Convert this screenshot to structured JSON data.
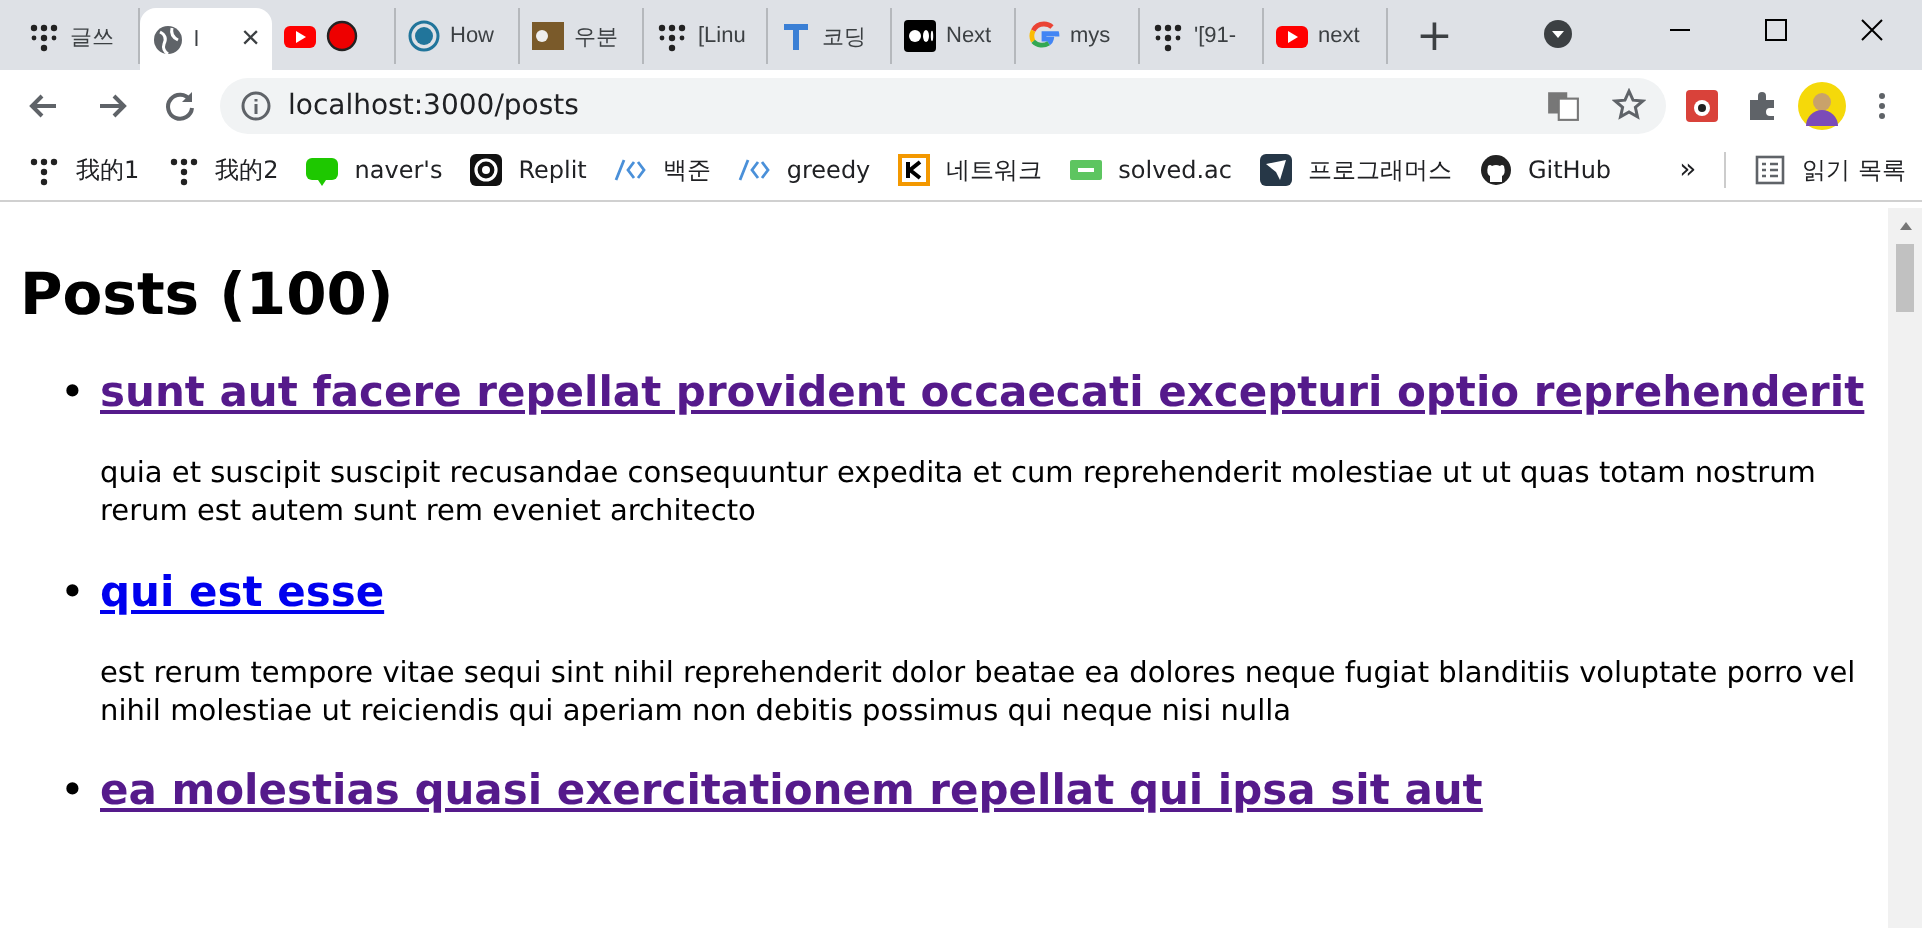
{
  "tabs": [
    {
      "label": "글쓰",
      "selected": false
    },
    {
      "label": "l",
      "selected": true,
      "close": "×"
    },
    {
      "selected": false
    },
    {
      "label": "How",
      "selected": false
    },
    {
      "label": "우분",
      "selected": false
    },
    {
      "label": "[Linu",
      "selected": false
    },
    {
      "label": "코딩",
      "selected": false
    },
    {
      "label": "Next",
      "selected": false
    },
    {
      "label": "mys",
      "selected": false
    },
    {
      "label": "'[91-",
      "selected": false
    },
    {
      "label": "next",
      "selected": false
    }
  ],
  "new_tab": "+",
  "address": "localhost:3000/posts",
  "bookmarks": [
    {
      "label": "我的1"
    },
    {
      "label": "我的2"
    },
    {
      "label": "naver's"
    },
    {
      "label": "Replit"
    },
    {
      "label": "백준"
    },
    {
      "label": "greedy"
    },
    {
      "label": "네트워크"
    },
    {
      "label": "solved.ac"
    },
    {
      "label": "프로그래머스"
    },
    {
      "label": "GitHub"
    }
  ],
  "more": "»",
  "reading_list": "읽기 목록",
  "heading": "Posts (100)",
  "posts": [
    {
      "marker": "•",
      "title": "sunt aut facere repellat provident occaecati excepturi optio reprehenderit",
      "visited": true,
      "body": "quia et suscipit suscipit recusandae consequuntur expedita et cum reprehenderit molestiae ut ut quas totam nostrum rerum est autem sunt rem eveniet architecto"
    },
    {
      "marker": "•",
      "title": "qui est esse",
      "visited": false,
      "body": "est rerum tempore vitae sequi sint nihil reprehenderit dolor beatae ea dolores neque fugiat blanditiis voluptate porro vel nihil molestiae ut reiciendis qui aperiam non debitis possimus qui neque nisi nulla"
    },
    {
      "marker": "•",
      "title": "ea molestias quasi exercitationem repellat qui ipsa sit aut",
      "visited": true
    }
  ]
}
